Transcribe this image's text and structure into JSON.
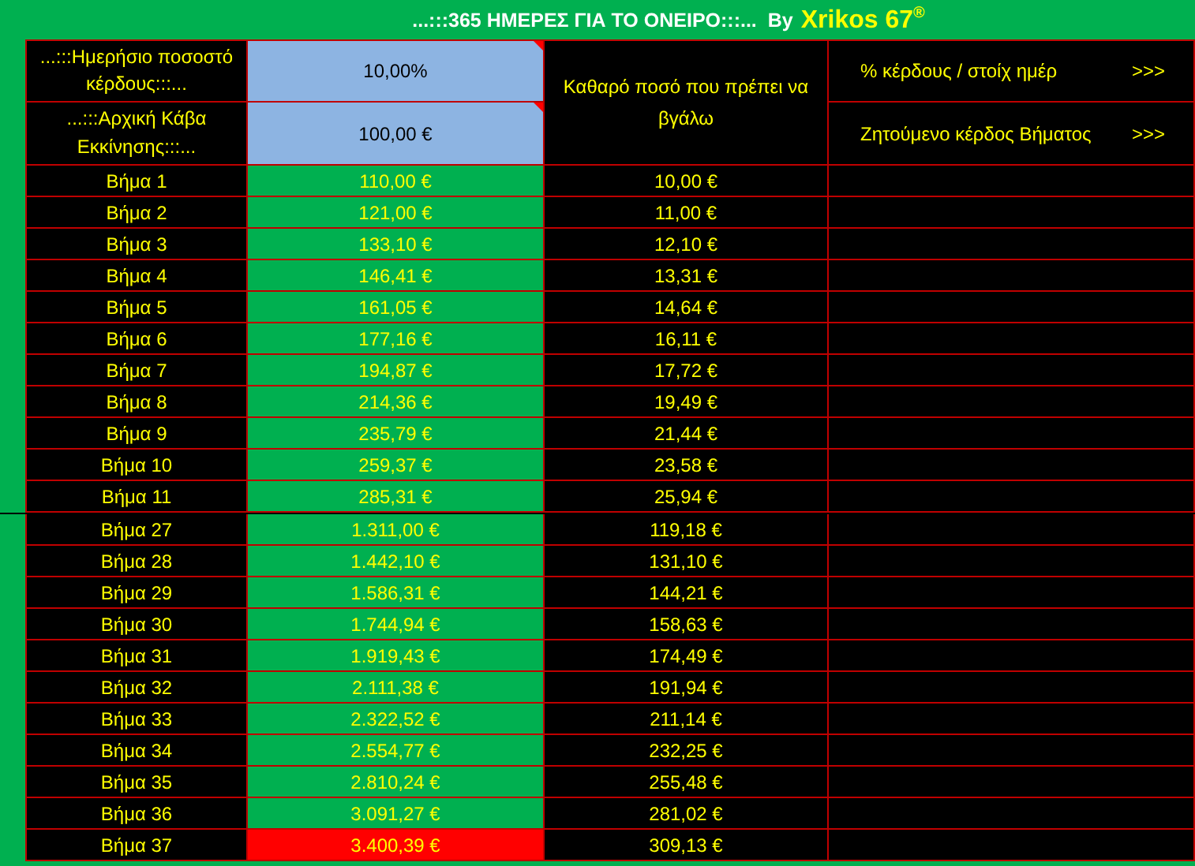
{
  "title": {
    "text": "...:::365 ΗΜΕΡΕΣ ΓΙΑ ΤΟ ΟΝΕΙΡΟ:::...  By",
    "author": "Xrikos 67$^{®}$"
  },
  "inputs": [
    {
      "label": "...:::Ημερήσιο ποσοστό κέρδους:::...",
      "value": "10,00%",
      "has_comment": true
    },
    {
      "label": "...:::Αρχική Κάβα Εκκίνησης:::...",
      "value": "100,00 €",
      "has_comment": true
    }
  ],
  "net_header": "Καθαρό ποσό που πρέπει να βγάλω",
  "links": [
    {
      "label": "% κέρδους / στοίχ ημέρ",
      "arrow": ">>>"
    },
    {
      "label": "Ζητούμενο κέρδος Βήματος",
      "arrow": ">>>"
    }
  ],
  "upper_pane_rows": [
    {
      "step": "Βήμα 1",
      "balance": "110,00 €",
      "net": "10,00 €",
      "color": "#00b050"
    },
    {
      "step": "Βήμα 2",
      "balance": "121,00 €",
      "net": "11,00 €",
      "color": "#00b050"
    },
    {
      "step": "Βήμα 3",
      "balance": "133,10 €",
      "net": "12,10 €",
      "color": "#00b050"
    },
    {
      "step": "Βήμα 4",
      "balance": "146,41 €",
      "net": "13,31 €",
      "color": "#00b050"
    },
    {
      "step": "Βήμα 5",
      "balance": "161,05 €",
      "net": "14,64 €",
      "color": "#00b050"
    },
    {
      "step": "Βήμα 6",
      "balance": "177,16 €",
      "net": "16,11 €",
      "color": "#00b050"
    },
    {
      "step": "Βήμα 7",
      "balance": "194,87 €",
      "net": "17,72 €",
      "color": "#00b050"
    },
    {
      "step": "Βήμα 8",
      "balance": "214,36 €",
      "net": "19,49 €",
      "color": "#00b050"
    },
    {
      "step": "Βήμα 9",
      "balance": "235,79 €",
      "net": "21,44 €",
      "color": "#00b050"
    },
    {
      "step": "Βήμα 10",
      "balance": "259,37 €",
      "net": "23,58 €",
      "color": "#00b050"
    },
    {
      "step": "Βήμα 11",
      "balance": "285,31 €",
      "net": "25,94 €",
      "color": "#00b050"
    }
  ],
  "lower_pane_rows": [
    {
      "step": "Βήμα 27",
      "balance": "1.311,00 €",
      "net": "119,18 €",
      "color": "#00b050"
    },
    {
      "step": "Βήμα 28",
      "balance": "1.442,10 €",
      "net": "131,10 €",
      "color": "#00b050"
    },
    {
      "step": "Βήμα 29",
      "balance": "1.586,31 €",
      "net": "144,21 €",
      "color": "#00b050"
    },
    {
      "step": "Βήμα 30",
      "balance": "1.744,94 €",
      "net": "158,63 €",
      "color": "#00b050"
    },
    {
      "step": "Βήμα 31",
      "balance": "1.919,43 €",
      "net": "174,49 €",
      "color": "#00b050"
    },
    {
      "step": "Βήμα 32",
      "balance": "2.111,38 €",
      "net": "191,94 €",
      "color": "#00b050"
    },
    {
      "step": "Βήμα 33",
      "balance": "2.322,52 €",
      "net": "211,14 €",
      "color": "#00b050"
    },
    {
      "step": "Βήμα 34",
      "balance": "2.554,77 €",
      "net": "232,25 €",
      "color": "#00b050"
    },
    {
      "step": "Βήμα 35",
      "balance": "2.810,24 €",
      "net": "255,48 €",
      "color": "#00b050"
    },
    {
      "step": "Βήμα 36",
      "balance": "3.091,27 €",
      "net": "281,02 €",
      "color": "#00b050"
    },
    {
      "step": "Βήμα 37",
      "balance": "3.400,39 €",
      "net": "309,13 €",
      "color": "#ff0000"
    }
  ]
}
